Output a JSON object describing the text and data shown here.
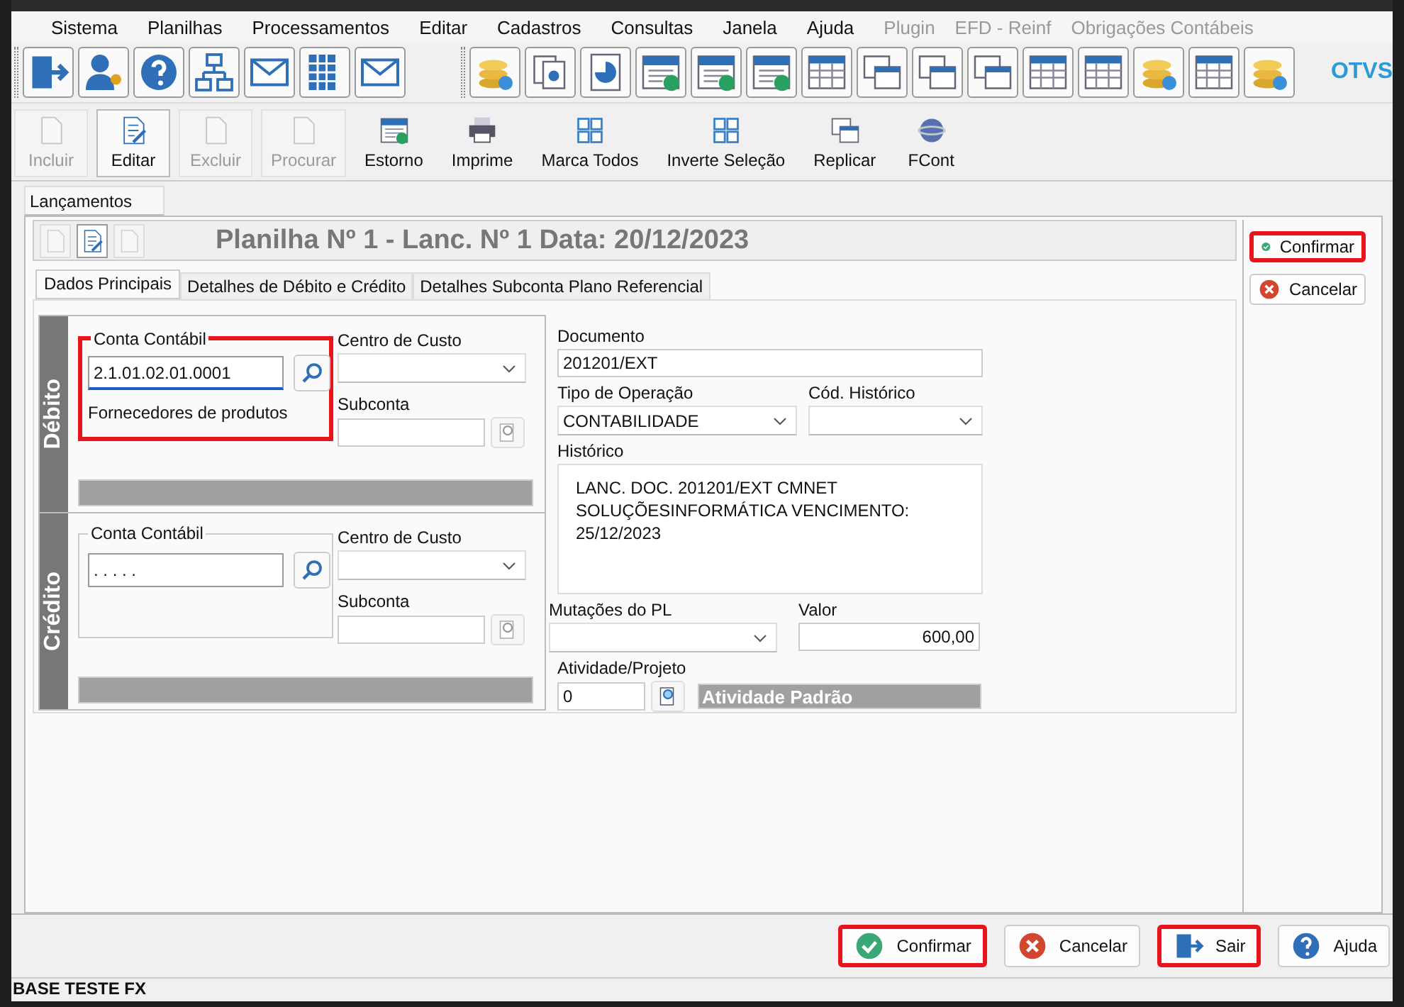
{
  "menu": [
    {
      "label": "Sistema",
      "disabled": false
    },
    {
      "label": "Planilhas",
      "disabled": false
    },
    {
      "label": "Processamentos",
      "disabled": false
    },
    {
      "label": "Editar",
      "disabled": false
    },
    {
      "label": "Cadastros",
      "disabled": false
    },
    {
      "label": "Consultas",
      "disabled": false
    },
    {
      "label": "Janela",
      "disabled": false
    },
    {
      "label": "Ajuda",
      "disabled": false
    },
    {
      "label": "Plugin",
      "disabled": true
    },
    {
      "label": "EFD - Reinf",
      "disabled": true
    },
    {
      "label": "Obrigações Contábeis",
      "disabled": true
    }
  ],
  "logo": "OTVS",
  "actions": [
    {
      "label": "Incluir",
      "disabled": true,
      "pressed": false
    },
    {
      "label": "Editar",
      "disabled": false,
      "pressed": true
    },
    {
      "label": "Excluir",
      "disabled": true,
      "pressed": false
    },
    {
      "label": "Procurar",
      "disabled": true,
      "pressed": false
    },
    {
      "label": "Estorno",
      "disabled": false,
      "pressed": false
    },
    {
      "label": "Imprime",
      "disabled": false,
      "pressed": false
    },
    {
      "label": "Marca Todos",
      "disabled": false,
      "pressed": false
    },
    {
      "label": "Inverte Seleção",
      "disabled": false,
      "pressed": false
    },
    {
      "label": "Replicar",
      "disabled": false,
      "pressed": false
    },
    {
      "label": "FCont",
      "disabled": false,
      "pressed": false
    }
  ],
  "window_tabs": [
    {
      "label": "Lançamentos",
      "selected": true
    }
  ],
  "header": {
    "tools": [
      {
        "disabled": true,
        "pressed": false
      },
      {
        "disabled": false,
        "pressed": true
      },
      {
        "disabled": true,
        "pressed": false
      }
    ],
    "title": "Planilha Nº 1 - Lanc. Nº 1 Data: 20/12/2023"
  },
  "tabs": [
    {
      "label": "Dados Principais",
      "selected": true
    },
    {
      "label": "Detalhes de Débito e Crédito",
      "selected": false
    },
    {
      "label": "Detalhes Subconta Plano Referencial",
      "selected": false
    }
  ],
  "sections": [
    {
      "title": "Débito",
      "account_label": "Conta Contábil",
      "account_value": "2.1.01.02.01.0001",
      "account_name": "Fornecedores de produtos",
      "highlighted": true,
      "focused": true,
      "cost_center_label": "Centro de Custo",
      "subaccount_label": "Subconta"
    },
    {
      "title": "Crédito",
      "account_label": "Conta Contábil",
      "account_value": ". . . . .",
      "highlighted": false,
      "focused": false,
      "cost_center_label": "Centro de Custo",
      "subaccount_label": "Subconta"
    }
  ],
  "details": {
    "documento_label": "Documento",
    "documento": "201201/EXT",
    "tipo_label": "Tipo de Operação",
    "tipo": "CONTABILIDADE",
    "cod_historico_label": "Cód. Histórico",
    "historico_label": "Histórico",
    "historico": "LANC. DOC. 201201/EXT CMNET SOLUÇÕESINFORMÁTICA VENCIMENTO: 25/12/2023",
    "mutacoes_label": "Mutações do PL",
    "valor_label": "Valor",
    "valor": "600,00",
    "atividade_label": "Atividade/Projeto",
    "atividade": "0",
    "atividade_nome": "Atividade Padrão"
  },
  "side_buttons": [
    {
      "label": "Confirmar",
      "kind": "confirm",
      "highlighted": true
    },
    {
      "label": "Cancelar",
      "kind": "cancel",
      "highlighted": false
    }
  ],
  "footer_buttons": [
    {
      "label": "Confirmar",
      "kind": "confirm",
      "highlighted": true
    },
    {
      "label": "Cancelar",
      "kind": "cancel",
      "highlighted": false
    },
    {
      "label": "Sair",
      "kind": "exit",
      "highlighted": true
    },
    {
      "label": "Ajuda",
      "kind": "help",
      "highlighted": false
    }
  ],
  "status_bar": "BASE TESTE FX"
}
